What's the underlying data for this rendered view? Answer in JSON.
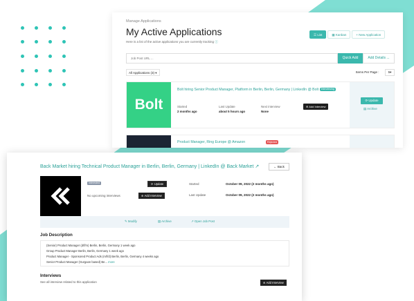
{
  "colors": {
    "accent": "#3bb8ad",
    "band": "#80e0d4",
    "bolt_green": "#34d186",
    "dark_button": "#1f1f1f",
    "rejected_red": "#e45757"
  },
  "back_window": {
    "breadcrumb": "Manage Applications",
    "title": "My Active Applications",
    "subtitle": "Here is a list of the active applications you are currently tracking",
    "view_buttons": [
      {
        "label": "List",
        "icon": "list-icon",
        "active": true
      },
      {
        "label": "Kanban",
        "icon": "kanban-icon",
        "active": false
      },
      {
        "label": "New Application",
        "icon": "plus-icon",
        "active": false
      }
    ],
    "url_input": {
      "placeholder": "Job Post URL ..."
    },
    "quick_add": "Quick Add",
    "add_details": "Add Details ...",
    "filter": "All Applications (3)",
    "items_per_page_label": "Items Per Page :",
    "items_per_page_value": "5",
    "applications": [
      {
        "title": "Bolt hiring Senior Product Manager, Platform in Berlin, Berlin, Germany | LinkedIn @ Bolt",
        "status": "Interviewing",
        "logo_text": "Bolt",
        "started_label": "Started",
        "started_value": "2 months ago",
        "last_update_label": "Last Update",
        "last_update_value": "about 5 hours ago",
        "next_interview_label": "Next interview",
        "next_interview_value": "None",
        "add_interview": "Add Interview",
        "update": "Update",
        "archive": "Archive"
      },
      {
        "title": "Product Manager, Ring Europe @ Amazon",
        "status": "Rejected"
      }
    ]
  },
  "front_window": {
    "title": "Back Market hiring Technical Product Manager in Berlin, Berlin, Germany | LinkedIn @ Back Market",
    "back": "Back",
    "status_chip": "Interested",
    "no_upcoming": "No upcoming interviews",
    "update": "Update",
    "add_interview": "Add Interview",
    "started_label": "Started",
    "started_value": "October 09, 2022 (2 months ago)",
    "last_update_label": "Last Update",
    "last_update_value": "October 09, 2022 (2 months ago)",
    "actions": [
      {
        "label": "Modify",
        "icon": "edit-icon"
      },
      {
        "label": "Archive",
        "icon": "archive-icon"
      },
      {
        "label": "Open Job Post",
        "icon": "external-link-icon"
      }
    ],
    "job_description_heading": "Job Description",
    "job_description_lines": [
      "(Senior) Product Manager (d/f/m) Berlin, Berlin, Germany 1 week ago",
      "Group Product Manager Berlin, Berlin, Germany 1 week ago",
      "Product Manager - Sponsored Product Ads (m/f/d) Berlin, Berlin, Germany 4 weeks ago",
      "Senior Product Manager (Gurgaon based) Be..."
    ],
    "more": "more",
    "interviews_heading": "Interviews",
    "interviews_sub": "See all interview related to this application",
    "add_interview_2": "Add Interview"
  }
}
